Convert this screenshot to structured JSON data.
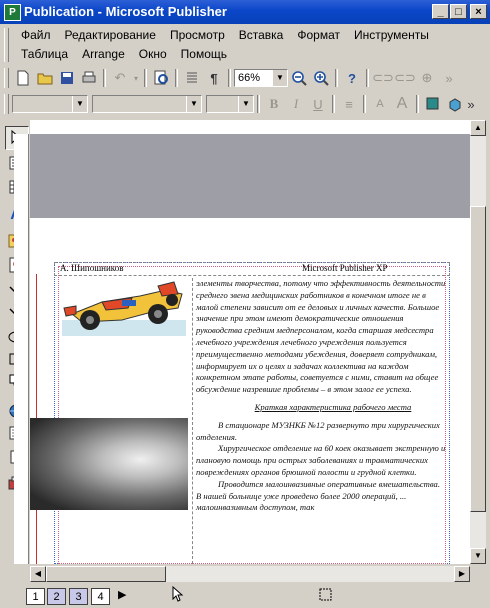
{
  "window": {
    "title": "Publication - Microsoft Publisher"
  },
  "menu": {
    "row1": [
      "Файл",
      "Редактирование",
      "Просмотр",
      "Вставка",
      "Формат",
      "Инструменты"
    ],
    "row2": [
      "Таблица",
      "Arrange",
      "Окно",
      "Помощь"
    ]
  },
  "toolbar": {
    "zoom": "66%"
  },
  "document": {
    "header_left": "А. Шипошников",
    "header_right": "Microsoft Publisher XP",
    "paragraphs": [
      "элементы творчества, потому что эффективность деятельности среднего звена медицинских работников в конечном итоге не в малой степени зависит от ее деловых и личных качеств. Большое значение при этом имеют демократические отношения руководства средним медперсоналом, когда старшая медсестра лечебного учреждения лечебного учреждения пользуется преимущественно методами убеждения, доверяет сотрудникам, информирует их о целях и задачах коллектива на каждом конкретном этапе работы, советуется с ними, ставит на общее обсуждение назревшие проблемы – в этом залог ее успеха."
    ],
    "heading": "Краткая характеристика рабочего места",
    "paragraphs2": [
      "В стационаре МУЗНКБ №12 развернуто три хирургических отделения.",
      "Хирургическое отделение на 60 коек оказывает экстренную и плановую помощь при острых заболеваниях и травматических повреждениях органов брюшной полости и грудной клетки.",
      "Проводится малоинвазивные оперативные вмешательства. В нашей больнице уже проведено более 2000 операций, ... малоинвазивным доступом, так"
    ]
  },
  "pages": [
    "1",
    "2",
    "3",
    "4"
  ],
  "colors": {
    "titlebar": "#0a46c8",
    "chrome": "#d4d0c8"
  }
}
